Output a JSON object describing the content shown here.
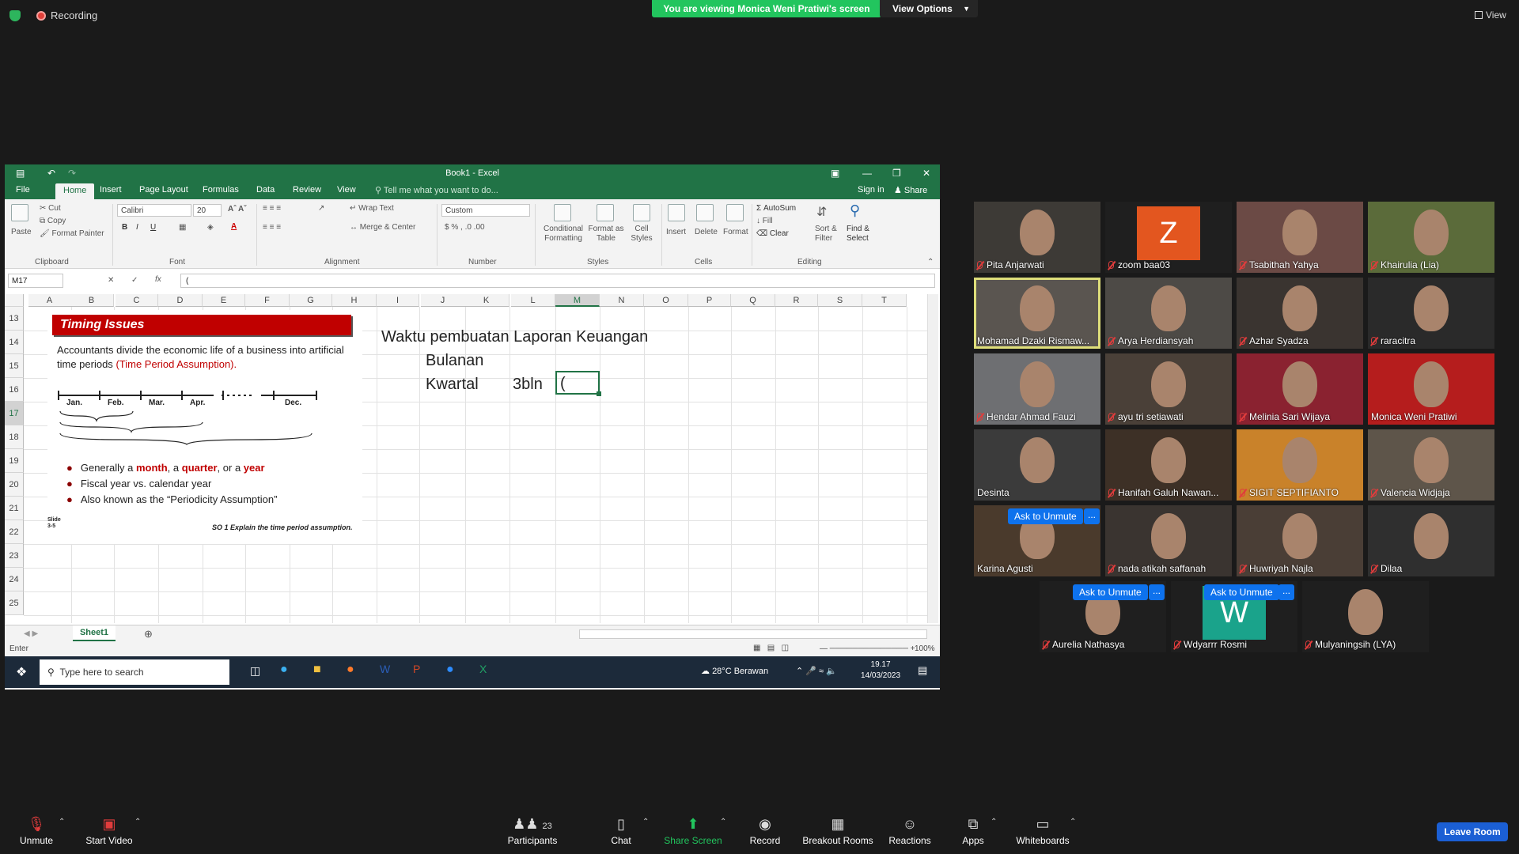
{
  "topbar": {
    "recording_label": "Recording",
    "viewing_banner": "You are viewing Monica Weni Pratiwi's screen",
    "view_options": "View Options",
    "view_label": "View"
  },
  "excel": {
    "title": "Book1 - Excel",
    "tabs": [
      "File",
      "Home",
      "Insert",
      "Page Layout",
      "Formulas",
      "Data",
      "Review",
      "View"
    ],
    "tell_me": "Tell me what you want to do...",
    "sign_in": "Sign in",
    "share": "Share",
    "ribbon": {
      "paste": "Paste",
      "cut": "Cut",
      "copy": "Copy",
      "format_painter": "Format Painter",
      "clipboard": "Clipboard",
      "font_name": "Calibri",
      "font_size": "20",
      "font": "Font",
      "wrap_text": "Wrap Text",
      "merge_center": "Merge & Center",
      "alignment": "Alignment",
      "number_format": "Custom",
      "number": "Number",
      "conditional": "Conditional Formatting",
      "format_as_table": "Format as Table",
      "cell_styles": "Cell Styles",
      "styles": "Styles",
      "insert": "Insert",
      "delete": "Delete",
      "format": "Format",
      "cells": "Cells",
      "autosum": "AutoSum",
      "fill": "Fill",
      "clear": "Clear",
      "sort_filter": "Sort & Filter",
      "find_select": "Find & Select",
      "editing": "Editing"
    },
    "name_box": "M17",
    "formula_value": "(",
    "columns": [
      "A",
      "B",
      "C",
      "D",
      "E",
      "F",
      "G",
      "H",
      "I",
      "J",
      "K",
      "L",
      "M",
      "N",
      "O",
      "P",
      "Q",
      "R",
      "S",
      "T"
    ],
    "rows": [
      "13",
      "14",
      "15",
      "16",
      "17",
      "18",
      "19",
      "20",
      "21",
      "22",
      "23",
      "24",
      "25"
    ],
    "cells": {
      "heading": "Waktu pembuatan Laporan Keuangan",
      "bulanan": "Bulanan",
      "kwartal": "Kwartal",
      "three_bln": "3bln",
      "active_entry": "("
    },
    "slide": {
      "title": "Timing Issues",
      "intro": "Accountants divide the economic life of a business into artificial time periods",
      "intro_highlight": "(Time Period Assumption).",
      "months": [
        "Jan.",
        "Feb.",
        "Mar.",
        "Apr.",
        "Dec."
      ],
      "bullet1_a": "Generally a ",
      "bullet1_month": "month",
      "bullet1_b": ", a ",
      "bullet1_quarter": "quarter",
      "bullet1_c": ", or a ",
      "bullet1_year": "year",
      "bullet2": "Fiscal year vs. calendar year",
      "bullet3": "Also known as the “Periodicity Assumption”",
      "slide_no": "Slide 3-5",
      "footer": "SO 1  Explain the time period assumption."
    },
    "sheet_tab": "Sheet1",
    "status_mode": "Enter",
    "zoom": "100%",
    "taskbar": {
      "search": "Type here to search",
      "weather": "28°C  Berawan",
      "time": "19.17",
      "date": "14/03/2023"
    }
  },
  "participants": [
    {
      "name": "Pita Anjarwati"
    },
    {
      "name": "zoom baa03",
      "initial": "Z"
    },
    {
      "name": "Tsabithah Yahya"
    },
    {
      "name": "Khairulia (Lia)"
    },
    {
      "name": "Mohamad Dzaki Rismaw..."
    },
    {
      "name": "Arya Herdiansyah"
    },
    {
      "name": "Azhar Syadza"
    },
    {
      "name": "raracitra"
    },
    {
      "name": "Hendar Ahmad Fauzi"
    },
    {
      "name": "ayu tri setiawati"
    },
    {
      "name": "Melinia Sari Wijaya"
    },
    {
      "name": "Monica Weni Pratiwi"
    },
    {
      "name": "Desinta"
    },
    {
      "name": "Hanifah Galuh Nawan..."
    },
    {
      "name": "SIGIT SEPTIFIANTO"
    },
    {
      "name": "Valencia Widjaja"
    },
    {
      "name": "Karina Agusti"
    },
    {
      "name": "nada atikah saffanah"
    },
    {
      "name": "Huwriyah Najla"
    },
    {
      "name": "Dilaa"
    },
    {
      "name": "Aurelia Nathasya"
    },
    {
      "name": "Wdyarrr Rosmi",
      "initial": "W"
    },
    {
      "name": "Mulyaningsih (LYA)"
    }
  ],
  "ask_to_unmute": "Ask to Unmute",
  "more": "...",
  "bottombar": {
    "unmute": "Unmute",
    "start_video": "Start Video",
    "participants": "Participants",
    "participant_count": "23",
    "chat": "Chat",
    "share_screen": "Share Screen",
    "record": "Record",
    "breakout_rooms": "Breakout Rooms",
    "reactions": "Reactions",
    "apps": "Apps",
    "whiteboards": "Whiteboards",
    "leave_room": "Leave Room"
  },
  "colors": {
    "excel_green": "#217346",
    "zoom_blue": "#0e72ed",
    "banner_green": "#22c55e",
    "slide_red": "#c00000"
  }
}
